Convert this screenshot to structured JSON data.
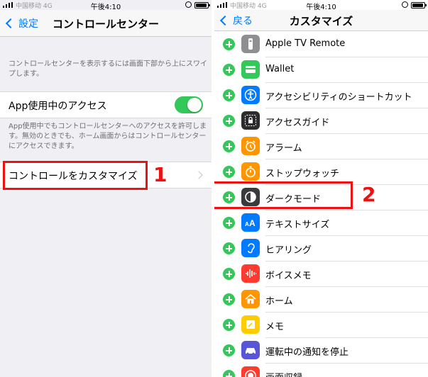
{
  "status_bar": {
    "carrier": "中国移动 4G",
    "time": "午後4:10"
  },
  "left_screen": {
    "nav": {
      "back_label": "設定",
      "title": "コントロールセンター"
    },
    "intro_text": "コントロールセンターを表示するには画面下部から上にスワイプします。",
    "access_row": {
      "label": "App使用中のアクセス",
      "toggle_on": true
    },
    "access_note": "App使用中でもコントロールセンターへのアクセスを許可します。無効のときでも、ホーム画面からはコントロールセンターにアクセスできます。",
    "customize_row": {
      "label": "コントロールをカスタマイズ"
    },
    "step_number": "1"
  },
  "right_screen": {
    "nav": {
      "back_label": "戻る",
      "title": "カスタマイズ"
    },
    "step_number": "2",
    "items": [
      {
        "label": "Apple TV Remote",
        "icon": "remote-icon",
        "color": "#8e8e93"
      },
      {
        "label": "Wallet",
        "icon": "wallet-icon",
        "color": "#34c759"
      },
      {
        "label": "アクセシビリティのショートカット",
        "icon": "accessibility-icon",
        "color": "#007aff"
      },
      {
        "label": "アクセスガイド",
        "icon": "lock-icon",
        "color": "#2c2c2e"
      },
      {
        "label": "アラーム",
        "icon": "alarm-icon",
        "color": "#ff9500"
      },
      {
        "label": "ストップウォッチ",
        "icon": "stopwatch-icon",
        "color": "#ff9500"
      },
      {
        "label": "ダークモード",
        "icon": "dark-mode-icon",
        "color": "#3a3a3c"
      },
      {
        "label": "テキストサイズ",
        "icon": "text-size-icon",
        "color": "#007aff"
      },
      {
        "label": "ヒアリング",
        "icon": "ear-icon",
        "color": "#007aff"
      },
      {
        "label": "ボイスメモ",
        "icon": "voice-memo-icon",
        "color": "#ff3b30"
      },
      {
        "label": "ホーム",
        "icon": "home-icon",
        "color": "#ff9500"
      },
      {
        "label": "メモ",
        "icon": "notes-icon",
        "color": "#ffcc00"
      },
      {
        "label": "運転中の通知を停止",
        "icon": "car-icon",
        "color": "#5856d6"
      },
      {
        "label": "画面収録",
        "icon": "record-icon",
        "color": "#ff3b30"
      }
    ]
  },
  "colors": {
    "accent": "#007aff",
    "toggle_on": "#34c759",
    "highlight": "#ee1111"
  }
}
